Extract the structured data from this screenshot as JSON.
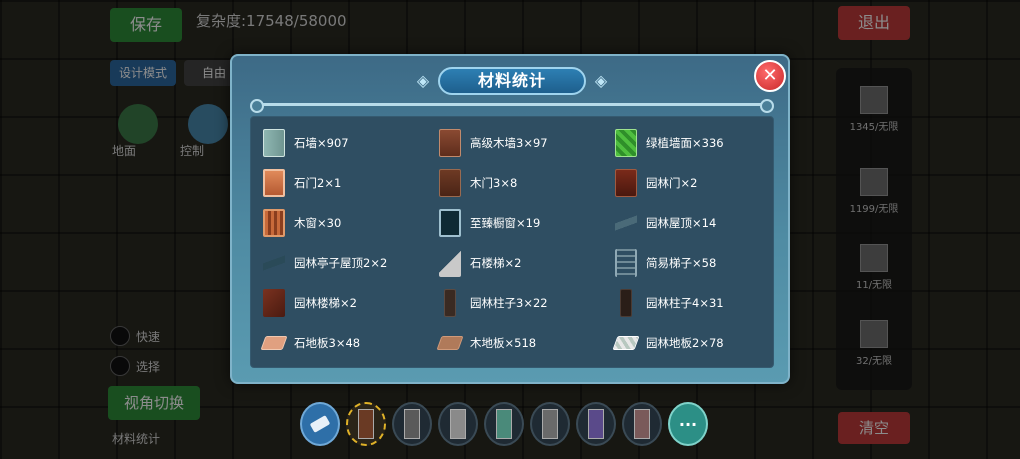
{
  "hud": {
    "save_label": "保存",
    "complexity_label": "复杂度:17548/58000",
    "exit_label": "退出",
    "mode_label": "设计模式",
    "free_label": "自由",
    "clear_label": "清空",
    "switch_label": "视角切换",
    "bg_texts": [
      "地面",
      "控制",
      "快速",
      "选择",
      "材料统计"
    ],
    "side_items": [
      "1345/无限",
      "1199/无限",
      "11/无限",
      "32/无限"
    ]
  },
  "dialog": {
    "title": "材料统计",
    "close_icon": "close-x-icon",
    "items": [
      {
        "label": "石墙×907",
        "icon": "stone-wall-icon"
      },
      {
        "label": "高级木墙3×97",
        "icon": "wood-wall-icon"
      },
      {
        "label": "绿植墙面×336",
        "icon": "green-wall-icon"
      },
      {
        "label": "石门2×1",
        "icon": "stone-door-icon"
      },
      {
        "label": "木门3×8",
        "icon": "wood-door-icon"
      },
      {
        "label": "园林门×2",
        "icon": "garden-door-icon"
      },
      {
        "label": "木窗×30",
        "icon": "wood-window-icon"
      },
      {
        "label": "至臻橱窗×19",
        "icon": "glass-window-icon"
      },
      {
        "label": "园林屋顶×14",
        "icon": "garden-roof-icon"
      },
      {
        "label": "园林亭子屋顶2×2",
        "icon": "pavilion-roof-icon"
      },
      {
        "label": "石楼梯×2",
        "icon": "stone-stair-icon"
      },
      {
        "label": "简易梯子×58",
        "icon": "ladder-icon"
      },
      {
        "label": "园林楼梯×2",
        "icon": "garden-stair-icon"
      },
      {
        "label": "园林柱子3×22",
        "icon": "pillar-3-icon"
      },
      {
        "label": "园林柱子4×31",
        "icon": "pillar-4-icon"
      },
      {
        "label": "石地板3×48",
        "icon": "stone-floor-icon"
      },
      {
        "label": "木地板×518",
        "icon": "wood-floor-icon"
      },
      {
        "label": "园林地板2×78",
        "icon": "garden-floor-icon"
      }
    ]
  },
  "hotbar": {
    "more_label": "···",
    "slot_colors": [
      "#6a3a24",
      "#5a5a5a",
      "#8a8a8a",
      "#4a8a7a",
      "#6a6a6a",
      "#5a4a8a",
      "#7a5a5a"
    ]
  }
}
